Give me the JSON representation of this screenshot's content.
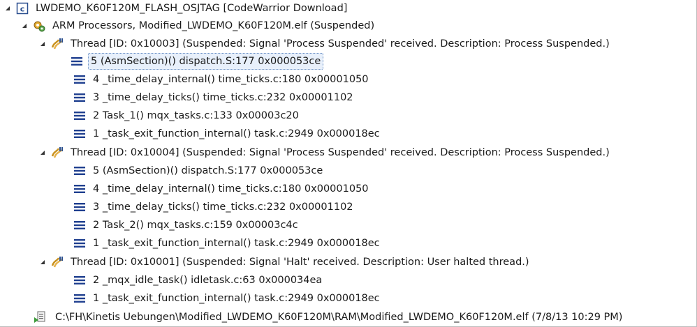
{
  "tree": {
    "launch": {
      "label": "LWDEMO_K60F120M_FLASH_OSJTAG [CodeWarrior Download]",
      "icon": "launch-config-icon"
    },
    "target": {
      "label": "ARM Processors, Modified_LWDEMO_K60F120M.elf (Suspended)",
      "icon": "processor-gears-icon"
    },
    "threads": [
      {
        "label": "Thread [ID: 0x10003] (Suspended: Signal 'Process Suspended' received. Description: Process Suspended.)",
        "frames": [
          "5 (AsmSection)() dispatch.S:177 0x000053ce",
          "4 _time_delay_internal() time_ticks.c:180 0x00001050",
          "3 _time_delay_ticks() time_ticks.c:232 0x00001102",
          "2 Task_1() mqx_tasks.c:133 0x00003c20",
          "1 _task_exit_function_internal() task.c:2949 0x000018ec"
        ]
      },
      {
        "label": "Thread [ID: 0x10004] (Suspended: Signal 'Process Suspended' received. Description: Process Suspended.)",
        "frames": [
          "5 (AsmSection)() dispatch.S:177 0x000053ce",
          "4 _time_delay_internal() time_ticks.c:180 0x00001050",
          "3 _time_delay_ticks() time_ticks.c:232 0x00001102",
          "2 Task_2() mqx_tasks.c:159 0x00003c4c",
          "1 _task_exit_function_internal() task.c:2949 0x000018ec"
        ]
      },
      {
        "label": "Thread [ID: 0x10001] (Suspended: Signal 'Halt' received. Description: User halted thread.)",
        "frames": [
          "2 _mqx_idle_task() idletask.c:63 0x000034ea",
          "1 _task_exit_function_internal() task.c:2949 0x000018ec"
        ]
      }
    ],
    "process": {
      "label": "C:\\FH\\Kinetis Uebungen\\Modified_LWDEMO_K60F120M\\RAM\\Modified_LWDEMO_K60F120M.elf (7/8/13 10:29 PM)",
      "icon": "process-executable-icon"
    },
    "selected_frame": "5 (AsmSection)() dispatch.S:177 0x000053ce",
    "colors": {
      "selection_border": "#6a8fc4",
      "stack_frame_icon": "#1f3f8f",
      "thread_icon": "#c9921e"
    }
  }
}
